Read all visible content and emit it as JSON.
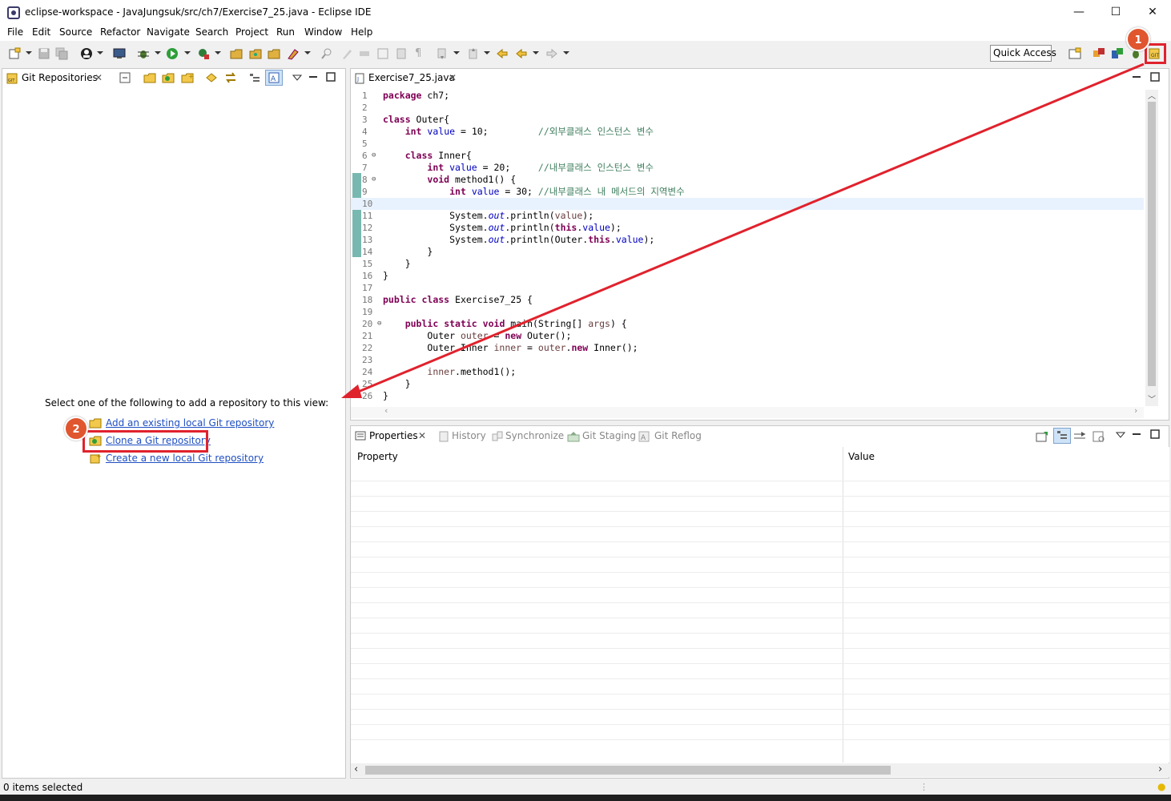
{
  "window": {
    "title": "eclipse-workspace - JavaJungsuk/src/ch7/Exercise7_25.java - Eclipse IDE",
    "minimize": "—",
    "maximize": "☐",
    "close": "✕"
  },
  "menu": [
    "File",
    "Edit",
    "Source",
    "Refactor",
    "Navigate",
    "Search",
    "Project",
    "Run",
    "Window",
    "Help"
  ],
  "toolbar": {
    "quick_access": "Quick Access"
  },
  "left_view": {
    "tab_label": "Git Repositories",
    "prompt": "Select one of the following to add a repository to this view:",
    "links": {
      "add_existing": "Add an existing local Git repository",
      "clone": "Clone a Git repository",
      "create_new": "Create a new local Git repository"
    }
  },
  "editor": {
    "tab_label": "Exercise7_25.java",
    "current_line": 10,
    "lines": [
      {
        "n": "1",
        "fold": "",
        "code": "package ch7;"
      },
      {
        "n": "2",
        "fold": "",
        "code": ""
      },
      {
        "n": "3",
        "fold": "",
        "code": "class Outer{"
      },
      {
        "n": "4",
        "fold": "",
        "code": "    int value = 10;         //외부클래스 인스턴스 변수"
      },
      {
        "n": "5",
        "fold": "",
        "code": ""
      },
      {
        "n": "6",
        "fold": "⊖",
        "code": "    class Inner{"
      },
      {
        "n": "7",
        "fold": "",
        "code": "        int value = 20;     //내부클래스 인스턴스 변수"
      },
      {
        "n": "8",
        "fold": "⊖",
        "code": "        void method1() {"
      },
      {
        "n": "9",
        "fold": "",
        "code": "            int value = 30; //내부클래스 내 메서드의 지역변수"
      },
      {
        "n": "10",
        "fold": "",
        "code": ""
      },
      {
        "n": "11",
        "fold": "",
        "code": "            System.out.println(value);"
      },
      {
        "n": "12",
        "fold": "",
        "code": "            System.out.println(this.value);"
      },
      {
        "n": "13",
        "fold": "",
        "code": "            System.out.println(Outer.this.value);"
      },
      {
        "n": "14",
        "fold": "",
        "code": "        }"
      },
      {
        "n": "15",
        "fold": "",
        "code": "    }"
      },
      {
        "n": "16",
        "fold": "",
        "code": "}"
      },
      {
        "n": "17",
        "fold": "",
        "code": ""
      },
      {
        "n": "18",
        "fold": "",
        "code": "public class Exercise7_25 {"
      },
      {
        "n": "19",
        "fold": "",
        "code": ""
      },
      {
        "n": "20",
        "fold": "⊖",
        "code": "    public static void main(String[] args) {"
      },
      {
        "n": "21",
        "fold": "",
        "code": "        Outer outer = new Outer();"
      },
      {
        "n": "22",
        "fold": "",
        "code": "        Outer.Inner inner = outer.new Inner();"
      },
      {
        "n": "23",
        "fold": "",
        "code": ""
      },
      {
        "n": "24",
        "fold": "",
        "code": "        inner.method1();"
      },
      {
        "n": "25",
        "fold": "",
        "code": "    }"
      },
      {
        "n": "26",
        "fold": "",
        "code": "}"
      }
    ]
  },
  "bottom_view": {
    "tabs": [
      "Properties",
      "History",
      "Synchronize",
      "Git Staging",
      "Git Reflog"
    ],
    "active_tab": "Properties",
    "columns": [
      "Property",
      "Value"
    ]
  },
  "status": {
    "text": "0 items selected"
  },
  "annotations": {
    "badge1": "1",
    "badge2": "2",
    "color": "#e0222d"
  }
}
